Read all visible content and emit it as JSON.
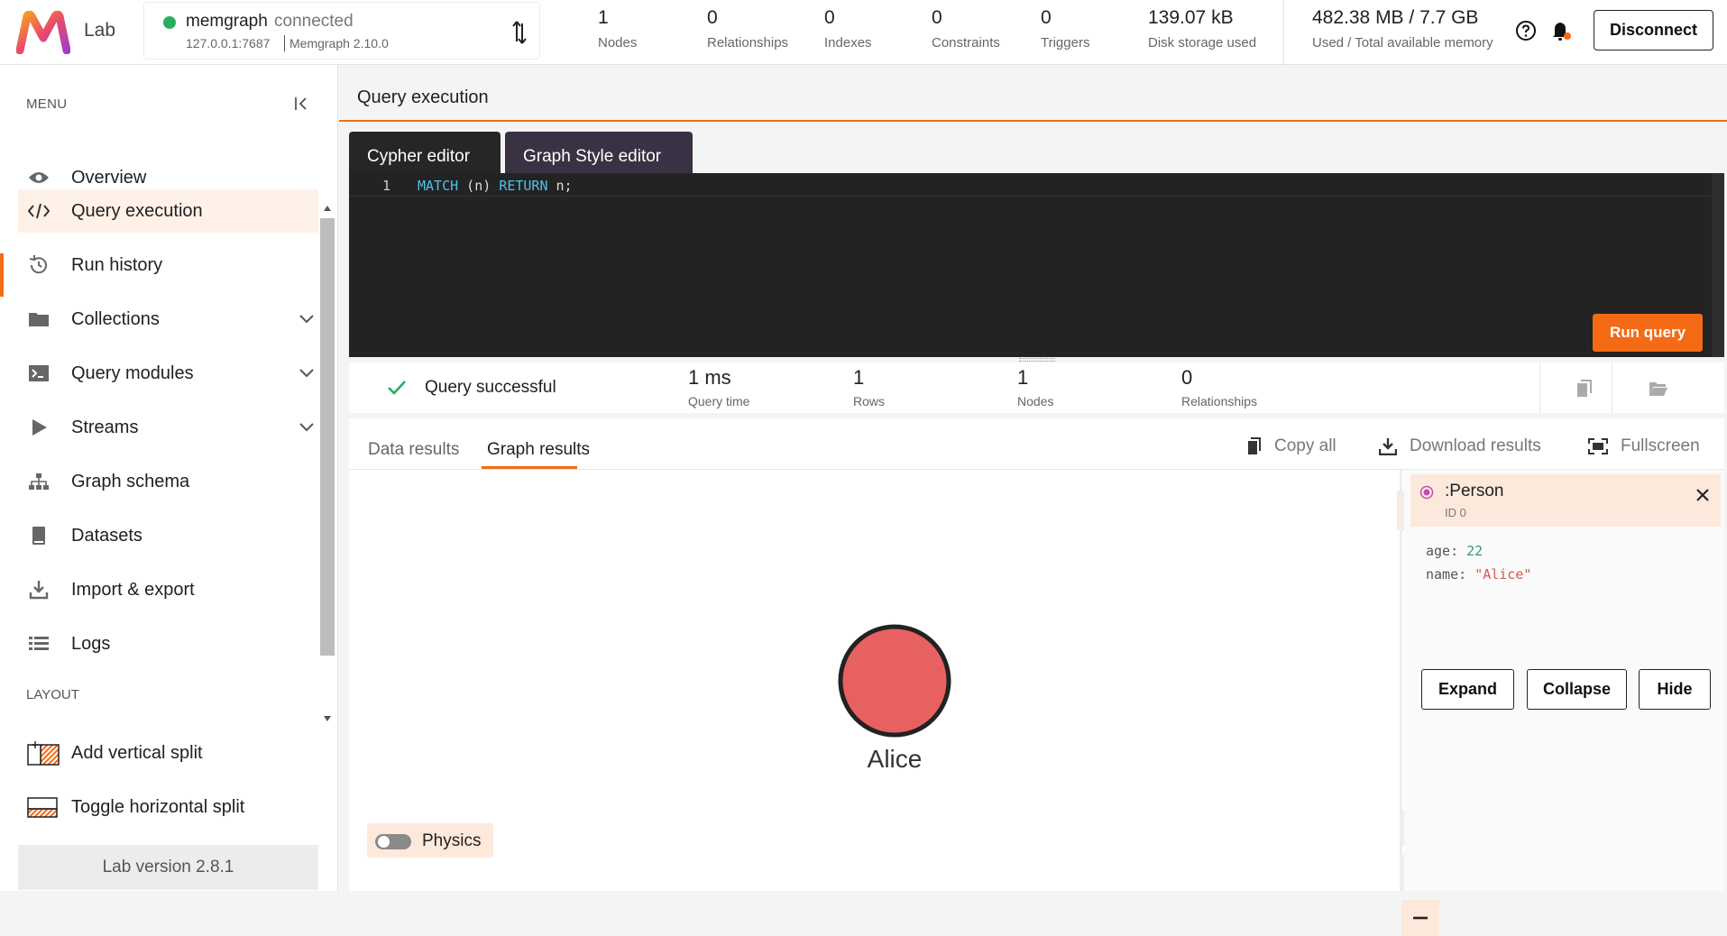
{
  "app": {
    "logo_text": "Lab"
  },
  "connection": {
    "name": "memgraph",
    "status": "connected",
    "host": "127.0.0.1:7687",
    "version": "Memgraph 2.10.0",
    "status_color": "#27ae60"
  },
  "stats": [
    {
      "value": "1",
      "label": "Nodes"
    },
    {
      "value": "0",
      "label": "Relationships"
    },
    {
      "value": "0",
      "label": "Indexes"
    },
    {
      "value": "0",
      "label": "Constraints"
    },
    {
      "value": "0",
      "label": "Triggers"
    },
    {
      "value": "139.07 kB",
      "label": "Disk storage used"
    },
    {
      "value": "482.38 MB / 7.7 GB",
      "label": "Used / Total available memory"
    }
  ],
  "header": {
    "disconnect_label": "Disconnect"
  },
  "sidebar": {
    "menu_title": "MENU",
    "items": [
      {
        "label": "Overview",
        "icon": "eye-icon"
      },
      {
        "label": "Query execution",
        "icon": "code-icon",
        "active": true
      },
      {
        "label": "Run history",
        "icon": "history-icon"
      },
      {
        "label": "Collections",
        "icon": "folder-icon",
        "expandable": true
      },
      {
        "label": "Query modules",
        "icon": "terminal-icon",
        "expandable": true
      },
      {
        "label": "Streams",
        "icon": "play-icon",
        "expandable": true
      },
      {
        "label": "Graph schema",
        "icon": "schema-icon"
      },
      {
        "label": "Datasets",
        "icon": "book-icon"
      },
      {
        "label": "Import & export",
        "icon": "download-icon"
      },
      {
        "label": "Logs",
        "icon": "list-icon"
      }
    ],
    "layout_title": "LAYOUT",
    "layout_items": [
      {
        "label": "Add vertical split",
        "icon": "vertical-split-icon"
      },
      {
        "label": "Toggle horizontal split",
        "icon": "horizontal-split-icon"
      }
    ],
    "version": "Lab version 2.8.1"
  },
  "main": {
    "title": "Query execution",
    "tabs": [
      {
        "label": "Cypher editor",
        "active": true
      },
      {
        "label": "Graph Style editor",
        "active": false
      }
    ],
    "editor": {
      "line_number": "1",
      "kw1": "MATCH",
      "mid": " (n) ",
      "kw2": "RETURN",
      "tail": " n;"
    },
    "run_label": "Run query",
    "status": {
      "text": "Query successful",
      "metrics": [
        {
          "value": "1 ms",
          "label": "Query time"
        },
        {
          "value": "1",
          "label": "Rows"
        },
        {
          "value": "1",
          "label": "Nodes"
        },
        {
          "value": "0",
          "label": "Relationships"
        }
      ]
    },
    "results": {
      "tabs": [
        {
          "label": "Data results",
          "active": false
        },
        {
          "label": "Graph results",
          "active": true
        }
      ],
      "actions": {
        "copy": "Copy all",
        "download": "Download results",
        "fullscreen": "Fullscreen"
      },
      "node": {
        "label": "Alice",
        "color": "#e86161"
      },
      "physics_label": "Physics",
      "physics_on": false
    },
    "detail": {
      "label": ":Person",
      "label_color": "#c04cb0",
      "id": "ID 0",
      "properties": [
        {
          "key": "age",
          "value": "22"
        },
        {
          "key": "name",
          "value": "\"Alice\""
        }
      ],
      "buttons": {
        "expand": "Expand",
        "collapse": "Collapse",
        "hide": "Hide"
      }
    }
  },
  "colors": {
    "accent": "#f56a15",
    "success": "#27ae60"
  }
}
